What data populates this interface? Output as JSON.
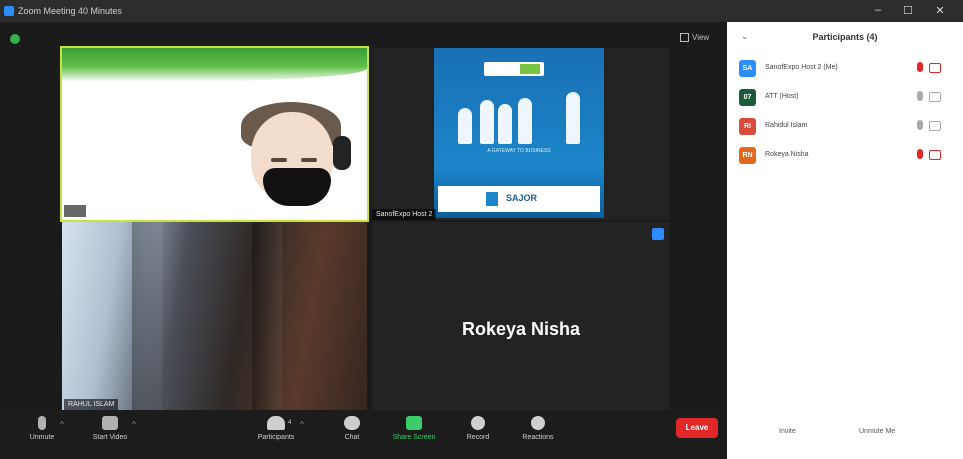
{
  "window": {
    "title": "Zoom Meeting 40 Minutes"
  },
  "view_button": {
    "label": "View"
  },
  "tiles": [
    {
      "name": "",
      "kind": "video"
    },
    {
      "name": "SanofExpo Host 2",
      "kind": "screen-share"
    },
    {
      "name": "RAHUL ISLAM",
      "kind": "video"
    },
    {
      "name": "Rokeya Nisha",
      "kind": "avatar-name"
    }
  ],
  "shared_content": {
    "tagline": "A GATEWAY TO BUSINESS",
    "brand": "SAJOR"
  },
  "toolbar": {
    "items": [
      "Unmute",
      "Start Video",
      "Participants",
      "Chat",
      "Share Screen",
      "Record",
      "Reactions"
    ],
    "participants_count": "4",
    "leave_label": "Leave"
  },
  "participants_panel": {
    "title": "Participants (4)",
    "rows": [
      {
        "initials": "SA",
        "name": "SanofExpo Host 2 (Me)",
        "color": "#2d8cff"
      },
      {
        "initials": "07",
        "name": "ATT (Host)",
        "color": "#1d5c3a"
      },
      {
        "initials": "RI",
        "name": "Rahidul Islam",
        "color": "#d94b3a"
      },
      {
        "initials": "RN",
        "name": "Rokeya Nisha",
        "color": "#e06a1e"
      }
    ],
    "invite_label": "Invite",
    "unmute_me_label": "Unmute Me"
  },
  "colors": {
    "accent": "#2d8cff",
    "leave": "#e02828",
    "speaker_highlight": "#c8e43c"
  }
}
